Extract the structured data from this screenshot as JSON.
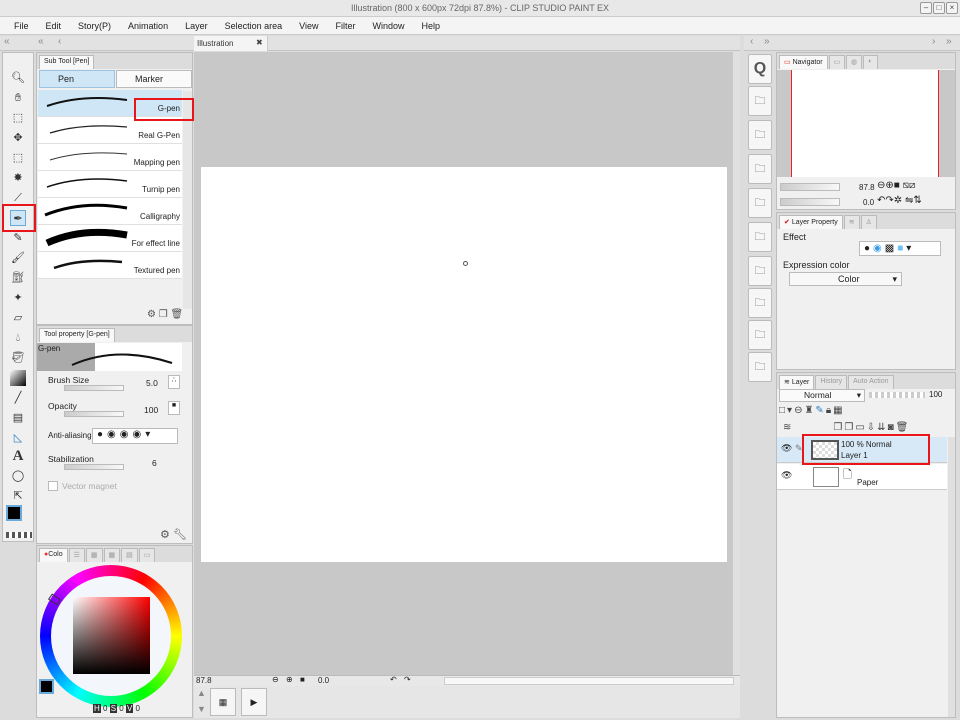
{
  "window": {
    "title": "Illustration (800 x 600px 72dpi 87.8%) - CLIP STUDIO PAINT EX"
  },
  "menu": [
    "File",
    "Edit",
    "Story(P)",
    "Animation",
    "Layer",
    "Selection area",
    "View",
    "Filter",
    "Window",
    "Help"
  ],
  "canvas_tab": {
    "label": "Illustration",
    "close": "✖"
  },
  "subtool": {
    "title": "Sub Tool [Pen]",
    "tabs": [
      "Pen",
      "Marker"
    ],
    "items": [
      "G-pen",
      "Real G-Pen",
      "Mapping pen",
      "Turnip pen",
      "Calligraphy",
      "For effect line",
      "Textured pen"
    ],
    "selected": "G-pen"
  },
  "toolprop": {
    "title": "Tool property [G-pen]",
    "brush_name": "G-pen",
    "brush_size_label": "Brush Size",
    "brush_size": "5.0",
    "opacity_label": "Opacity",
    "opacity": "100",
    "antialias_label": "Anti-aliasing",
    "stabilization_label": "Stabilization",
    "stabilization": "6",
    "vector_magnet_label": "Vector magnet"
  },
  "color": {
    "tab": "Colo",
    "h": "0",
    "s": "0",
    "v": "0",
    "hue_marker": "red",
    "main_color": "#000000",
    "sub_color": "#ffffff"
  },
  "navigator": {
    "tab": "Navigator",
    "zoom": "87.8",
    "rotation": "0.0"
  },
  "layer_property": {
    "tab": "Layer Property",
    "effect_label": "Effect",
    "expression_color_label": "Expression color",
    "expression_color": "Color"
  },
  "layer_panel": {
    "tabs": [
      "Layer",
      "History",
      "Auto Action"
    ],
    "blend_mode": "Normal",
    "opacity": "100",
    "layers": [
      {
        "info": "100 % Normal",
        "name": "Layer 1",
        "selected": true
      },
      {
        "info": "",
        "name": "Paper",
        "selected": false
      }
    ]
  },
  "bottom": {
    "zoom": "87.8",
    "rotation": "0.0"
  }
}
